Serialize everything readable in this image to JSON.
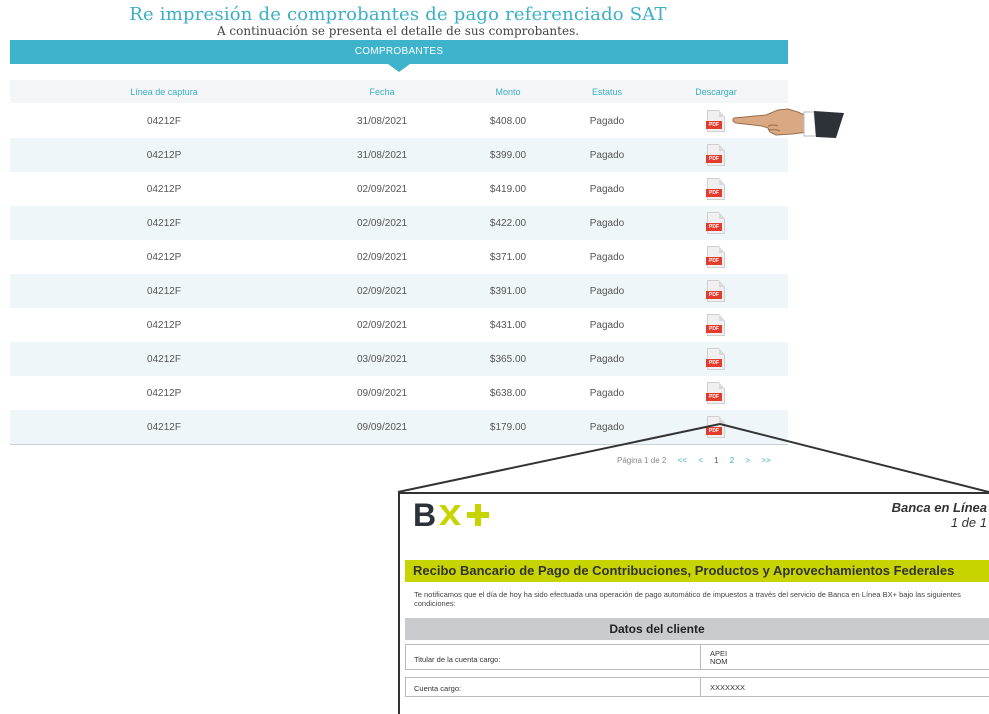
{
  "header": {
    "title": "Re impresión de comprobantes de pago referenciado SAT",
    "subtitle": "A continuación se presenta el detalle de sus comprobantes."
  },
  "banner": {
    "label": "COMPROBANTES"
  },
  "table": {
    "columns": [
      "Línea de captura",
      "Fecha",
      "Monto",
      "Estatus",
      "Descargar"
    ],
    "pdf_label": "PDF",
    "rows": [
      {
        "linea": "04212F",
        "fecha": "31/08/2021",
        "monto": "$408.00",
        "estatus": "Pagado"
      },
      {
        "linea": "04212P",
        "fecha": "31/08/2021",
        "monto": "$399.00",
        "estatus": "Pagado"
      },
      {
        "linea": "04212P",
        "fecha": "02/09/2021",
        "monto": "$419.00",
        "estatus": "Pagado"
      },
      {
        "linea": "04212F",
        "fecha": "02/09/2021",
        "monto": "$422.00",
        "estatus": "Pagado"
      },
      {
        "linea": "04212P",
        "fecha": "02/09/2021",
        "monto": "$371.00",
        "estatus": "Pagado"
      },
      {
        "linea": "04212F",
        "fecha": "02/09/2021",
        "monto": "$391.00",
        "estatus": "Pagado"
      },
      {
        "linea": "04212P",
        "fecha": "02/09/2021",
        "monto": "$431.00",
        "estatus": "Pagado"
      },
      {
        "linea": "04212F",
        "fecha": "03/09/2021",
        "monto": "$365.00",
        "estatus": "Pagado"
      },
      {
        "linea": "04212P",
        "fecha": "09/09/2021",
        "monto": "$638.00",
        "estatus": "Pagado"
      },
      {
        "linea": "04212F",
        "fecha": "09/09/2021",
        "monto": "$179.00",
        "estatus": "Pagado"
      }
    ]
  },
  "pagination": {
    "label": "Página 1 de 2",
    "first": "<<",
    "prev": "<",
    "page1": "1",
    "page2": "2",
    "next": ">",
    "last": ">>"
  },
  "receipt": {
    "logo_text": "BX+",
    "banca_title": "Banca en Línea",
    "page_indicator": "1 de 1",
    "recibo_title": "Recibo Bancario de Pago de Contribuciones, Productos y Aprovechamientos Federales",
    "notice": "Te notificamos que el día de hoy ha sido efectuada una operación de pago automático de impuestos a través del servicio de Banca en Línea BX+ bajo las siguientes condiciones:",
    "datos_title": "Datos del cliente",
    "titular_label": "Titular de la cuenta cargo:",
    "titular_value_1": "APEI",
    "titular_value_2": "NOM",
    "cuenta_label": "Cuenta cargo:",
    "cuenta_value": "XXXXXXX"
  },
  "colors": {
    "accent": "#3db3cc",
    "row_alt": "#eff6fa",
    "pdf_red": "#e53b2c",
    "logo_green": "#c8d400",
    "logo_dark": "#2c3238"
  }
}
